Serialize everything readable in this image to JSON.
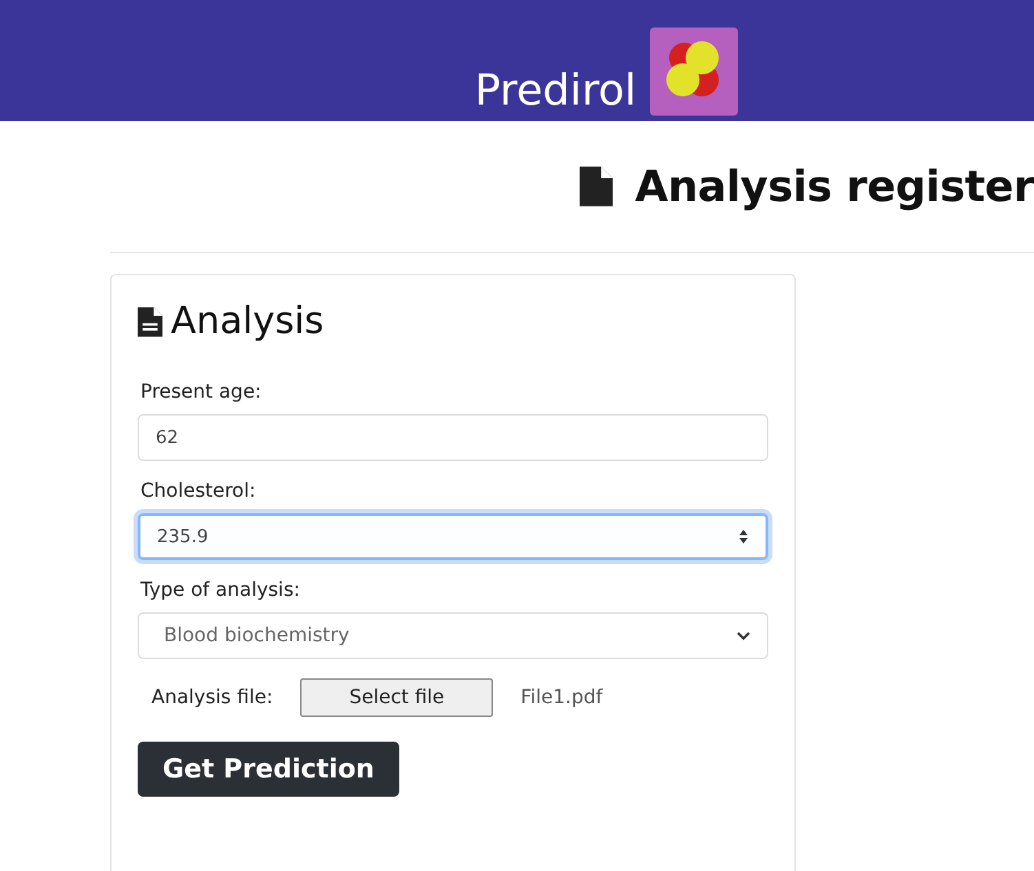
{
  "header": {
    "title": "Predirol"
  },
  "page": {
    "heading": "Analysis register"
  },
  "card": {
    "title": "Analysis",
    "fields": [
      {
        "kind": "text",
        "label": "Present age:",
        "value": "62",
        "focused": false
      },
      {
        "kind": "number",
        "label": "Cholesterol:",
        "value": "235.9",
        "focused": true
      },
      {
        "kind": "select",
        "label": "Type of analysis:",
        "value": "Blood biochemistry",
        "focused": false
      },
      {
        "kind": "file",
        "label": "Analysis file:",
        "button": "Select file",
        "value": "File1.pdf",
        "focused": false
      }
    ],
    "submit": "Get Prediction"
  }
}
